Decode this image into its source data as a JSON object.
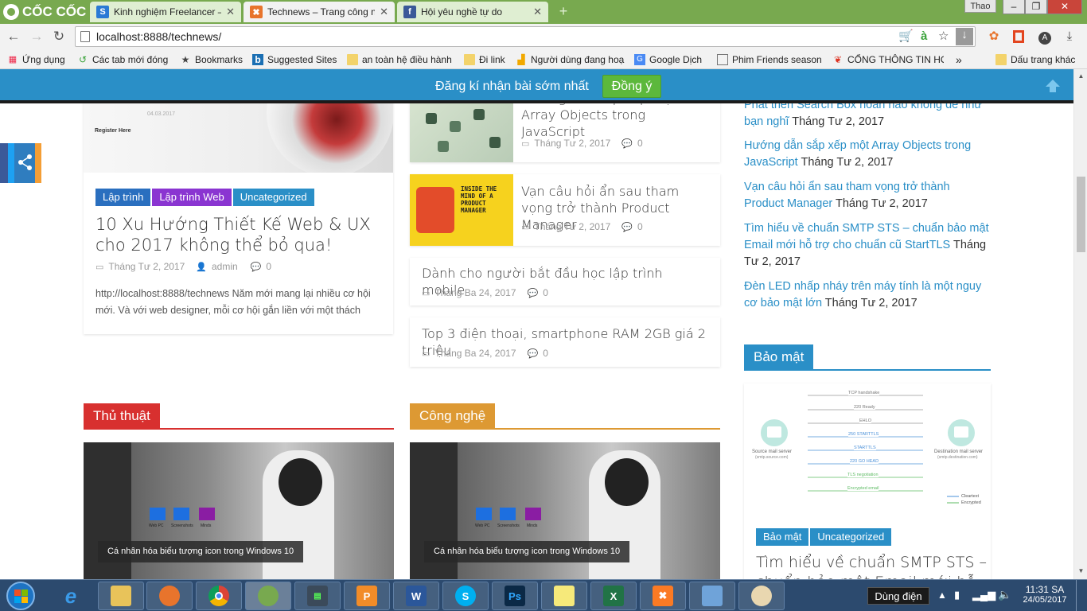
{
  "browser": {
    "brand": "CỐC CỐC",
    "tabs": [
      {
        "title": "Kinh nghiệm Freelancer –",
        "icon": "S",
        "color": "#2a7ad5"
      },
      {
        "title": "Technews – Trang công n",
        "icon": "✖",
        "color": "#e8742c"
      },
      {
        "title": "Hội yêu nghề tự do",
        "icon": "f",
        "color": "#3b5998"
      }
    ],
    "user": "Thao",
    "url": "localhost:8888/technews/",
    "bookmarks": [
      "Ứng dụng",
      "Các tab mới đóng",
      "Bookmarks",
      "Suggested Sites",
      "an toàn hệ điều hành",
      "Đi link",
      "Người dùng đang hoạ",
      "Google Dịch",
      "Phim Friends season",
      "CỔNG THÔNG TIN HỌ",
      "Dấu trang khác"
    ]
  },
  "notify": {
    "message": "Đăng kí nhận bài sớm nhất",
    "button": "Đồng ý"
  },
  "featured": {
    "img_text_a": "Register Here",
    "img_text_b": "04.03.2017",
    "categories": [
      "Lập trình",
      "Lập trình Web",
      "Uncategorized"
    ],
    "title": "10 Xu Hướng Thiết Kế Web & UX cho 2017 không thể bỏ qua!",
    "date": "Tháng Tư 2, 2017",
    "author": "admin",
    "comments": "0",
    "excerpt": "http://localhost:8888/technews Năm mới mang lại nhiều cơ hội mới. Và với web designer, mỗi cơ hội gắn liền với một thách"
  },
  "mid_posts": [
    {
      "title": "Hướng dẫn sắp xếp một Array Objects trong JavaScript",
      "date": "Tháng Tư 2, 2017",
      "comments": "0"
    },
    {
      "title": "Vạn câu hỏi ẩn sau tham vọng trở thành Product Manager",
      "date": "Tháng Tư 2, 2017",
      "comments": "0",
      "img_text": "INSIDE THE MIND OF A PRODUCT MANAGER"
    },
    {
      "title": "Dành cho người bắt đầu học lập trình mobile",
      "date": "Tháng Ba 24, 2017",
      "comments": "0"
    },
    {
      "title": "Top 3 điện thoại, smartphone RAM 2GB giá 2 triệu",
      "date": "Tháng Ba 24, 2017",
      "comments": "0"
    }
  ],
  "sidebar_links": [
    {
      "title": "Phát triển Search Box hoàn hảo không dễ như bạn nghĩ",
      "date": "Tháng Tư 2, 2017"
    },
    {
      "title": "Hướng dẫn sắp xếp một Array Objects trong JavaScript",
      "date": "Tháng Tư 2, 2017"
    },
    {
      "title": "Vạn câu hỏi ẩn sau tham vọng trở thành Product Manager",
      "date": "Tháng Tư 2, 2017"
    },
    {
      "title": "Tìm hiểu về chuẩn SMTP STS – chuẩn bảo mật Email mới hỗ trợ cho chuẩn cũ StartTLS",
      "date": "Tháng Tư 2, 2017"
    },
    {
      "title": "Đèn LED nhấp nháy trên máy tính là một nguy cơ bảo mật lớn",
      "date": "Tháng Tư 2, 2017"
    }
  ],
  "sections": {
    "thu_thuat": {
      "label": "Thủ thuật",
      "color": "#d8302f"
    },
    "cong_nghe": {
      "label": "Công nghệ",
      "color": "#dd9933"
    },
    "bao_mat": {
      "label": "Bảo mật",
      "color": "#2a8fc7"
    }
  },
  "bottom_cards": {
    "caption": "Cá nhân hóa biểu tượng icon trong Windows 10",
    "icon_labels": [
      "Web PC",
      "Screenshots",
      "Minds"
    ]
  },
  "security_post": {
    "categories": [
      "Bảo mật",
      "Uncategorized"
    ],
    "title": "Tìm hiểu về chuẩn SMTP STS – chuẩn bảo mật Email mới hỗ trợ",
    "diagram": {
      "left_label": "Source mail server",
      "left_sub": "(smtp.source.com)",
      "right_label": "Destination mail server",
      "right_sub": "(smtp.destination.com)",
      "steps": [
        "TCP handshake",
        "220 Ready",
        "EHLO",
        "250 STARTTLS",
        "STARTTLS",
        "220 GO HEAD",
        "TLS negotiation",
        "Encrypted email"
      ],
      "legend": [
        "Cleartext",
        "Encrypted"
      ]
    }
  },
  "taskbar": {
    "tooltip": "Dùng điện",
    "time": "11:31 SA",
    "date": "24/05/2017"
  }
}
